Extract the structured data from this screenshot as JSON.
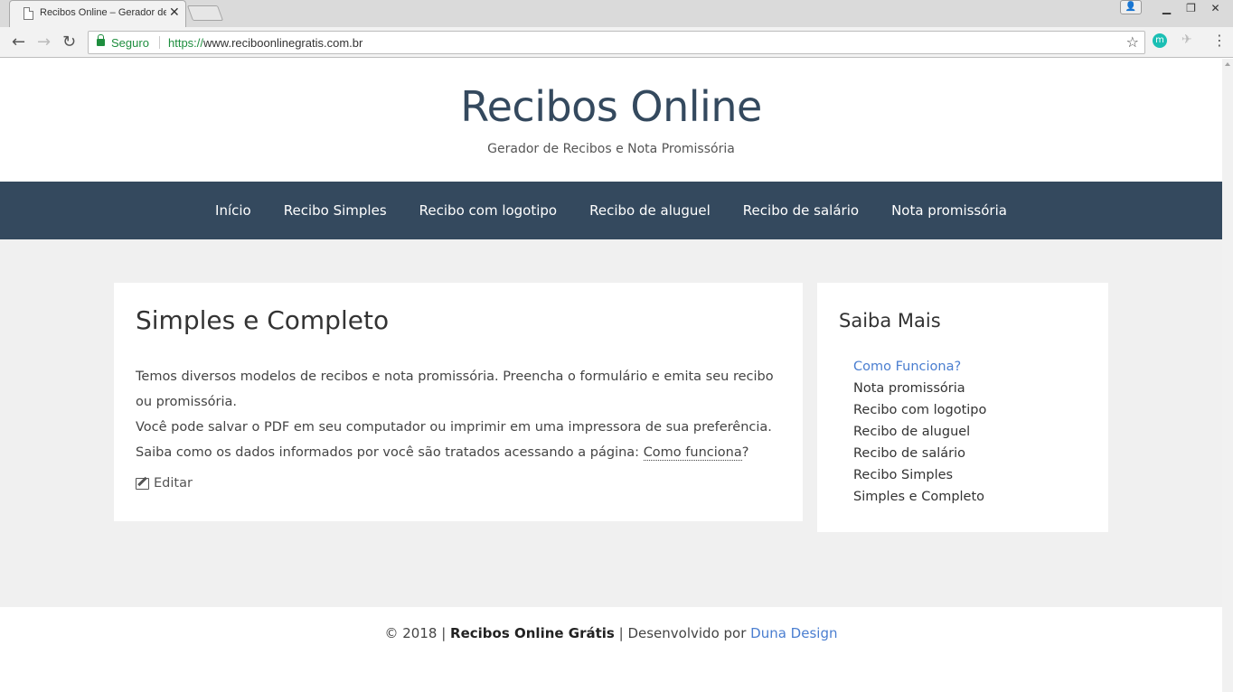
{
  "browser": {
    "tab_title": "Recibos Online – Gerador de Recibos",
    "secure_label": "Seguro",
    "url_scheme": "https://",
    "url_host": "www.reciboonlinegratis.com.br"
  },
  "header": {
    "site_title": "Recibos Online",
    "tagline": "Gerador de Recibos e Nota Promissória"
  },
  "nav": {
    "items": [
      "Início",
      "Recibo Simples",
      "Recibo com logotipo",
      "Recibo de aluguel",
      "Recibo de salário",
      "Nota promissória"
    ]
  },
  "article": {
    "title": "Simples e Completo",
    "line1": "Temos diversos modelos de recibos e nota promissória. Preencha o formulário e emita seu recibo ou promissória.",
    "line2": "Você pode salvar o PDF em seu computador ou imprimir em uma impressora de sua preferência.",
    "line3_prefix": "Saiba como os dados informados por você são tratados acessando a página: ",
    "line3_link": "Como funciona",
    "line3_suffix": "?",
    "edit_label": "Editar"
  },
  "sidebar": {
    "title": "Saiba Mais",
    "items": [
      "Como Funciona?",
      "Nota promissória",
      "Recibo com logotipo",
      "Recibo de aluguel",
      "Recibo de salário",
      "Recibo Simples",
      "Simples e Completo"
    ]
  },
  "footer": {
    "copyright": "© 2018 | ",
    "brand": "Recibos Online Grátis",
    "developed_by": " | Desenvolvido por ",
    "developer": "Duna Design"
  },
  "colors": {
    "nav_bg": "#34495e",
    "link": "#4a7ed0",
    "secure_green": "#1e8e3e",
    "page_bg": "#f0f0f0"
  },
  "icons": [
    "document-icon",
    "close-icon",
    "back-icon",
    "forward-icon",
    "reload-icon",
    "lock-icon",
    "star-icon",
    "extension-m-icon",
    "pin-icon",
    "menu-icon",
    "edit-icon",
    "user-icon",
    "minimize-icon",
    "restore-icon",
    "window-close-icon"
  ]
}
